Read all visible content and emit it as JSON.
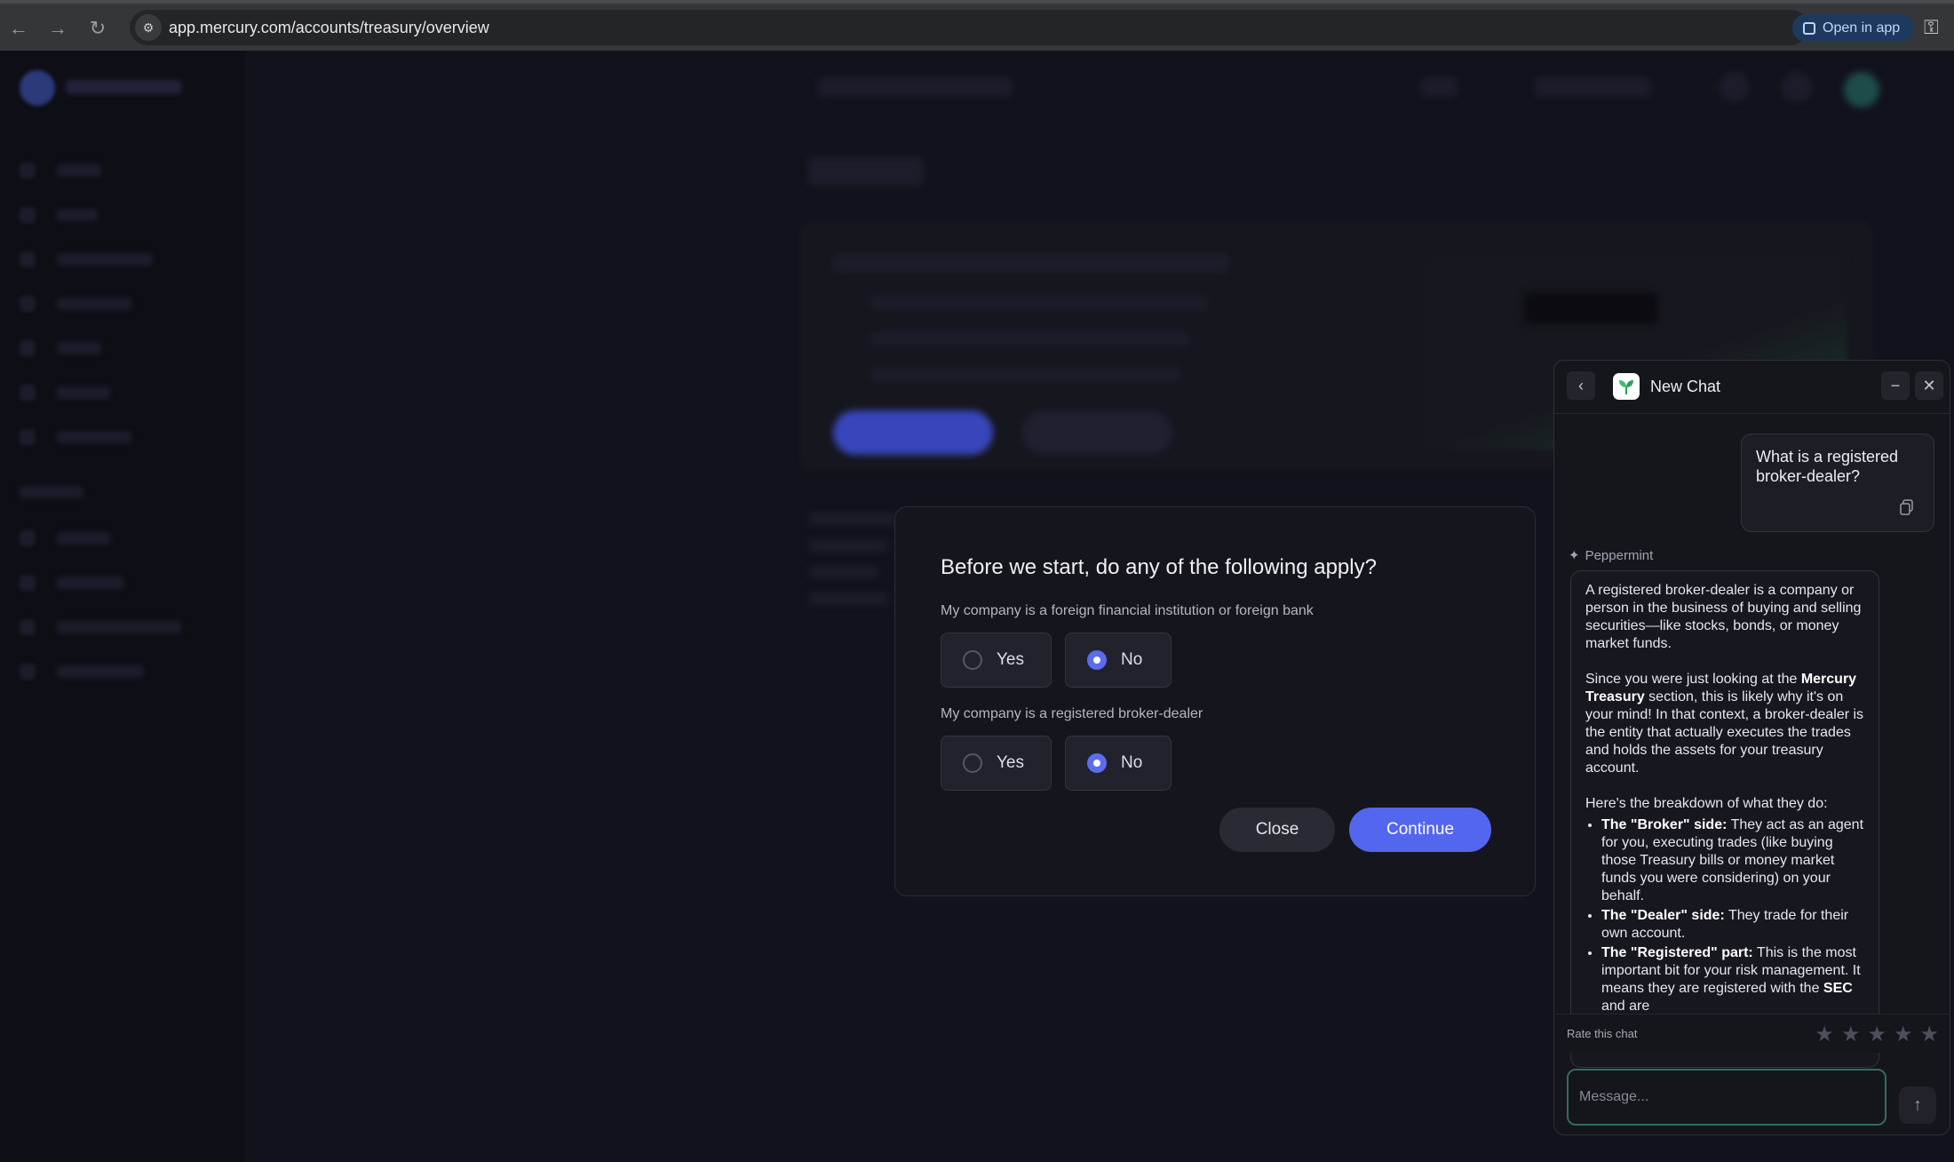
{
  "browser": {
    "url": "app.mercury.com/accounts/treasury/overview",
    "open_in_app": "Open in app"
  },
  "modal": {
    "title": "Before we start, do any of the following apply?",
    "questions": [
      {
        "label": "My company is a foreign financial institution or foreign bank",
        "options": [
          "Yes",
          "No"
        ],
        "selected": "No"
      },
      {
        "label": "My company is a registered broker-dealer",
        "options": [
          "Yes",
          "No"
        ],
        "selected": "No"
      }
    ],
    "close_label": "Close",
    "continue_label": "Continue"
  },
  "chat": {
    "title": "New Chat",
    "user_message": "What is a registered broker-dealer?",
    "bot_name": "Peppermint",
    "bot_para1": "A registered broker-dealer is a company or person in the business of buying and selling securities—like stocks, bonds, or money market funds.",
    "bot_para2_a": "Since you were just looking at the ",
    "bot_para2_b": "Mercury Treasury",
    "bot_para2_c": " section, this is likely why it's on your mind! In that context, a broker-dealer is the entity that actually executes the trades and holds the assets for your treasury account.",
    "bot_para3": "Here's the breakdown of what they do:",
    "bullets": [
      {
        "term": "The \"Broker\" side:",
        "text": " They act as an agent for you, executing trades (like buying those Treasury bills or money market funds you were considering) on your behalf."
      },
      {
        "term": "The \"Dealer\" side:",
        "text": " They trade for their own account."
      },
      {
        "term": "The \"Registered\" part:",
        "text": " This is the most important bit for your risk management. It means they are registered with the ",
        "term2": "SEC",
        "text2": " and are"
      }
    ],
    "rate_label": "Rate this chat",
    "stars": [
      "★",
      "★",
      "★",
      "★",
      "★"
    ],
    "input_placeholder": "Message..."
  }
}
